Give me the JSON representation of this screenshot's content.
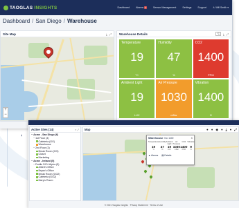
{
  "main": {
    "logo": {
      "text_a": "TAOGLAS",
      "text_b": "INSIGHTS"
    },
    "nav": [
      {
        "label": "Dashboard"
      },
      {
        "label": "Alarms",
        "badge": "9"
      },
      {
        "label": "Sensor Management"
      },
      {
        "label": "Settings"
      },
      {
        "label": "Support"
      },
      {
        "label": "Will Smith"
      }
    ],
    "breadcrumb": {
      "part1": "Dashboard",
      "part2": "San Diego",
      "part3": "Warehouse"
    },
    "site_map": {
      "title": "Site Map"
    },
    "details": {
      "title": "Warehouse Details",
      "unit_toggle": "°C",
      "tiles": [
        {
          "label": "Temperature",
          "value": "19",
          "unit": "°C",
          "color": "#8dc043"
        },
        {
          "label": "Humidity",
          "value": "47",
          "unit": "%",
          "color": "#8dc043"
        },
        {
          "label": "CO2",
          "value": "1400",
          "unit": "PPM",
          "color": "#de3b2f"
        },
        {
          "label": "Ambient Light",
          "value": "19",
          "unit": "LUX",
          "color": "#8dc043"
        },
        {
          "label": "Air Pressure",
          "value": "1030",
          "unit": "mBar",
          "color": "#f29c2c"
        },
        {
          "label": "Vibration",
          "value": "1400",
          "unit": "G",
          "color": "#8dc043"
        }
      ]
    },
    "footer": {
      "copy": "© 2021 Taoglas Insights",
      "privacy": "Privacy Statement",
      "terms": "Terms of Use"
    }
  },
  "second": {
    "sites": {
      "title": "Active Sites (14)",
      "tree": [
        {
          "label": "Acme - San Diego (6)",
          "level": 0
        },
        {
          "label": "1st Floor (3)",
          "level": 1
        },
        {
          "label": "Cafeteria (GG)",
          "level": 2,
          "status": "g"
        },
        {
          "label": "Warehouse",
          "level": 2,
          "status": "o"
        },
        {
          "label": "2nd Floor (3)",
          "level": 1
        },
        {
          "label": "Break Room (GG)",
          "level": 2,
          "status": "g"
        },
        {
          "label": "Closet",
          "level": 2,
          "status": "g"
        },
        {
          "label": "Marketing",
          "level": 2,
          "status": "g"
        },
        {
          "label": "Acme - Ireland (5)",
          "level": 0
        },
        {
          "label": "Dublin DCU Alpha (5)",
          "level": 1
        },
        {
          "label": "Albert's Office",
          "level": 2,
          "status": "g"
        },
        {
          "label": "Bryan's Office",
          "level": 2,
          "status": "g"
        },
        {
          "label": "Break Room (GG2)",
          "level": 2,
          "status": "g"
        },
        {
          "label": "Cafeteria (GG2)",
          "level": 2,
          "status": "g"
        },
        {
          "label": "Mary's Room",
          "level": 2,
          "status": "g"
        }
      ]
    },
    "map": {
      "title": "Map"
    },
    "popup": {
      "title": "Warehouse",
      "id": "No: 1400",
      "cols": [
        {
          "label": "Temperature",
          "value": "19",
          "unit": "°C"
        },
        {
          "label": "Humidity",
          "value": "47",
          "unit": "%"
        },
        {
          "label": "Ambient Light",
          "value": "19",
          "unit": "LUX"
        },
        {
          "label": "Air Pressure",
          "value": "1030",
          "unit": "mBar"
        },
        {
          "label": "CO2",
          "value": "1400",
          "unit": "PPM"
        },
        {
          "label": "Vibration",
          "value": "9",
          "unit": "G"
        }
      ],
      "link_alarms": "Alarms",
      "link_details": "Details"
    },
    "footer": {
      "text": "© 2021 Taoglas Insights · Privacy Statement · Terms of Use"
    }
  }
}
